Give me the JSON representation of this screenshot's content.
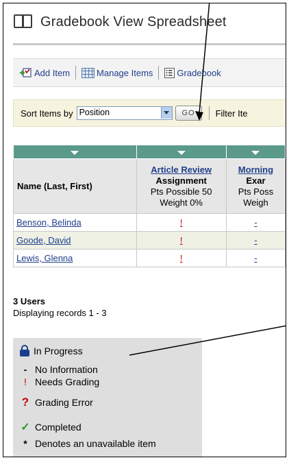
{
  "page": {
    "title": "Gradebook View Spreadsheet"
  },
  "toolbar": {
    "add_item": "Add Item",
    "manage_items": "Manage Items",
    "gradebook": "Gradebook"
  },
  "sortbar": {
    "sort_label": "Sort Items by",
    "sort_value": "Position",
    "go_label": "GO",
    "filter_label": "Filter Ite"
  },
  "grid": {
    "name_header": "Name (Last, First)",
    "columns": [
      {
        "link": "Article Review",
        "category": "Assignment",
        "points": "Pts Possible 50",
        "weight": "Weight 0%"
      },
      {
        "link": "Morning",
        "category": "Exar",
        "points": "Pts Poss",
        "weight": "Weigh"
      }
    ],
    "rows": [
      {
        "name": "Benson, Belinda",
        "col1": "!",
        "col2": "-"
      },
      {
        "name": "Goode, David",
        "col1": "!",
        "col2": "-"
      },
      {
        "name": "Lewis, Glenna",
        "col1": "!",
        "col2": "-"
      }
    ]
  },
  "summary": {
    "users": "3 Users",
    "records": "Displaying records 1 - 3"
  },
  "legend": {
    "items": [
      {
        "icon": "lock-icon",
        "symbol": "",
        "color": "#1b3f8f",
        "label": "In Progress"
      },
      {
        "icon": "dash-icon",
        "symbol": "-",
        "color": "#000000",
        "label": "No Information"
      },
      {
        "icon": "exclamation-icon",
        "symbol": "!",
        "color": "#c00000",
        "label": "Needs Grading"
      },
      {
        "icon": "question-icon",
        "symbol": "?",
        "color": "#c00000",
        "label": "Grading Error"
      },
      {
        "icon": "checkmark-icon",
        "symbol": "✓",
        "color": "#2e9b2e",
        "label": "Completed"
      },
      {
        "icon": "asterisk-icon",
        "symbol": "*",
        "color": "#000000",
        "label": "Denotes an unavailable item"
      }
    ]
  }
}
